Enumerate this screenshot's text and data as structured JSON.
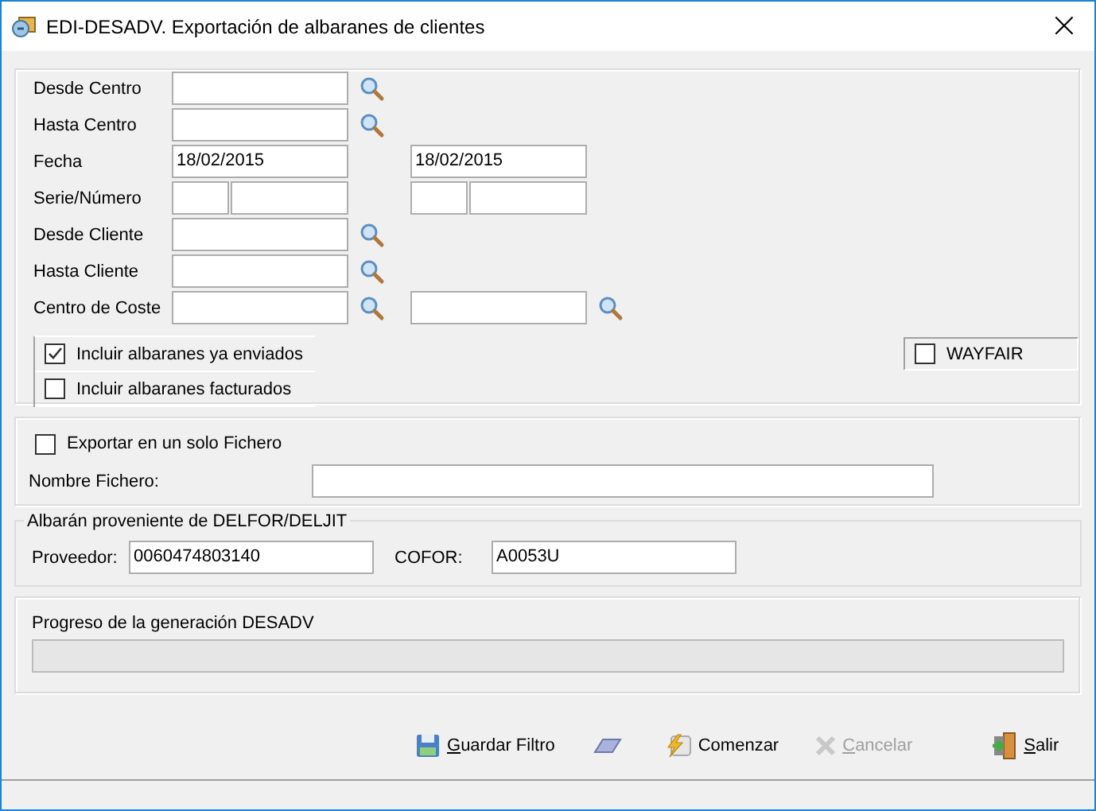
{
  "window": {
    "title": "EDI-DESADV. Exportación de albaranes de clientes",
    "close": "×"
  },
  "filter": {
    "rows": [
      {
        "label": "Desde Centro",
        "columns": [
          {
            "fields": [
              {
                "kind": "wide"
              }
            ],
            "lookup": true
          }
        ]
      },
      {
        "label": "Hasta Centro",
        "columns": [
          {
            "fields": [
              {
                "kind": "wide"
              }
            ],
            "lookup": true
          }
        ]
      },
      {
        "label": "Fecha",
        "columns": [
          {
            "fields": [
              {
                "kind": "wide",
                "value": "18/02/2015"
              }
            ],
            "lookup": false
          },
          {
            "fields": [
              {
                "kind": "wide",
                "value": "18/02/2015"
              }
            ],
            "lookup": false
          }
        ]
      },
      {
        "label": "Serie/Número",
        "columns": [
          {
            "fields": [
              {
                "kind": "short"
              },
              {
                "kind": "rest"
              }
            ],
            "lookup": false
          },
          {
            "fields": [
              {
                "kind": "short"
              },
              {
                "kind": "rest"
              }
            ],
            "lookup": false
          }
        ]
      },
      {
        "label": "Desde Cliente",
        "columns": [
          {
            "fields": [
              {
                "kind": "wide"
              }
            ],
            "lookup": true
          }
        ]
      },
      {
        "label": "Hasta Cliente",
        "columns": [
          {
            "fields": [
              {
                "kind": "wide"
              }
            ],
            "lookup": true
          }
        ]
      },
      {
        "label": "Centro de Coste",
        "columns": [
          {
            "fields": [
              {
                "kind": "wide"
              }
            ],
            "lookup": true
          },
          {
            "fields": [
              {
                "kind": "wide"
              }
            ],
            "lookup": true
          }
        ]
      }
    ],
    "options": [
      {
        "label": "Incluir albaranes ya enviados",
        "checked": true
      },
      {
        "label": "Incluir albaranes facturados",
        "checked": false
      }
    ],
    "wayfair": {
      "label": "WAYFAIR",
      "checked": false
    }
  },
  "export": {
    "single_file": {
      "label": "Exportar en un solo Fichero",
      "checked": false
    },
    "file_label": "Nombre Fichero:"
  },
  "delfor": {
    "legend": "Albarán proveniente de DELFOR/DELJIT",
    "supplier_label": "Proveedor:",
    "supplier": "0060474803140",
    "cofor_label": "COFOR:",
    "cofor": "A0053U"
  },
  "progress": {
    "label": "Progreso de la generación DESADV",
    "level": 0
  },
  "toolbar": [
    {
      "kind": "save",
      "label": "Guardar Filtro",
      "disabled": false
    },
    {
      "kind": "erase",
      "disabled": false
    },
    {
      "kind": "start",
      "label": "Comenzar",
      "disabled": false
    },
    {
      "kind": "cancel",
      "label": "Cancelar",
      "disabled": true
    },
    {
      "kind": "exit",
      "label": "Salir",
      "disabled": false
    }
  ]
}
